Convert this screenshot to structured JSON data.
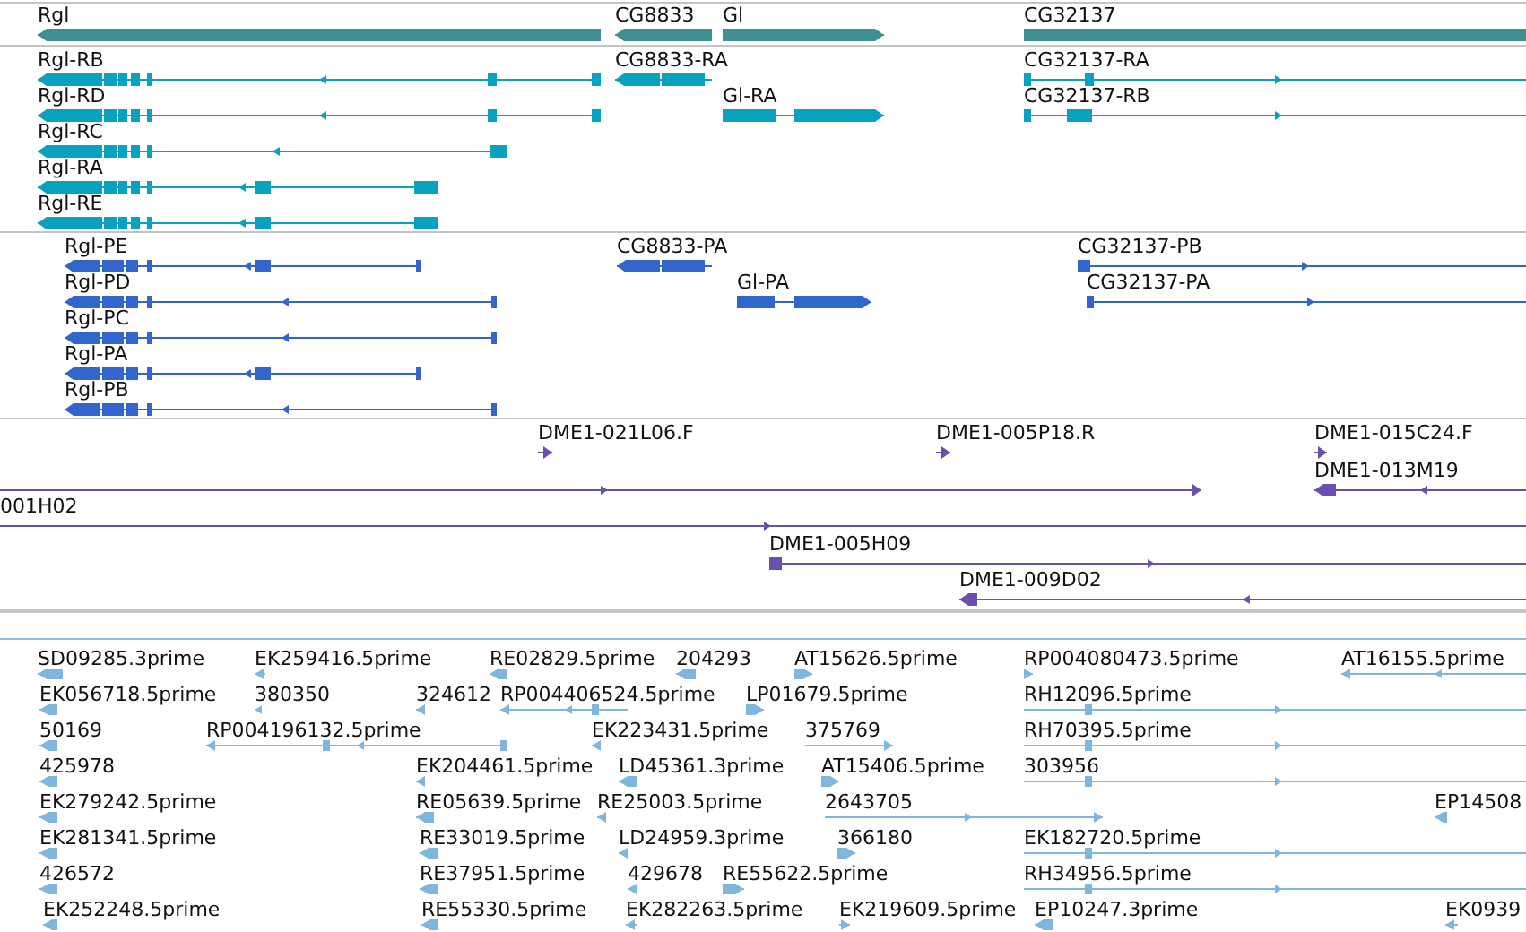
{
  "tracks": [
    {
      "kind": "genes",
      "color": "#3f8f94",
      "features": [
        {
          "label": "Rgl",
          "reverse": true
        },
        {
          "label": "CG8833",
          "reverse": true
        },
        {
          "label": "Gl",
          "reverse": false
        },
        {
          "label": "CG32137",
          "reverse": false
        }
      ]
    },
    {
      "kind": "transcripts",
      "color": "#0aa0c0",
      "features": [
        {
          "label": "Rgl-RB",
          "reverse": true
        },
        {
          "label": "CG8833-RA",
          "reverse": true
        },
        {
          "label": "CG32137-RA",
          "reverse": false
        },
        {
          "label": "Rgl-RD",
          "reverse": true
        },
        {
          "label": "Gl-RA",
          "reverse": false
        },
        {
          "label": "CG32137-RB",
          "reverse": false
        },
        {
          "label": "Rgl-RC",
          "reverse": true
        },
        {
          "label": "Rgl-RA",
          "reverse": true
        },
        {
          "label": "Rgl-RE",
          "reverse": true
        }
      ]
    },
    {
      "kind": "proteins",
      "color": "#3366cc",
      "features": [
        {
          "label": "Rgl-PE",
          "reverse": true
        },
        {
          "label": "CG8833-PA",
          "reverse": true
        },
        {
          "label": "CG32137-PB",
          "reverse": false
        },
        {
          "label": "Rgl-PD",
          "reverse": true
        },
        {
          "label": "Gl-PA",
          "reverse": false
        },
        {
          "label": "CG32137-PA",
          "reverse": false
        },
        {
          "label": "Rgl-PC",
          "reverse": true
        },
        {
          "label": "Rgl-PA",
          "reverse": true
        },
        {
          "label": "Rgl-PB",
          "reverse": true
        }
      ]
    },
    {
      "kind": "clones",
      "color": "#6a4fb0",
      "features": [
        {
          "label": "DME1-021L06.F",
          "reverse": false
        },
        {
          "label": "DME1-005P18.R",
          "reverse": false
        },
        {
          "label": "DME1-015C24.F",
          "reverse": false
        },
        {
          "reverse": false
        },
        {
          "label": "DME1-013M19",
          "reverse": true
        },
        {
          "label": "001H02",
          "reverse": false
        },
        {
          "label": "DME1-005H09",
          "reverse": false
        },
        {
          "label": "DME1-009D02",
          "reverse": true
        }
      ]
    },
    {
      "kind": "ests",
      "color": "#7fb6de",
      "features": [
        {
          "label": "SD09285.3prime",
          "reverse": true
        },
        {
          "label": "EK259416.5prime",
          "reverse": true
        },
        {
          "label": "RE02829.5prime",
          "reverse": true
        },
        {
          "label": "204293",
          "reverse": true
        },
        {
          "label": "AT15626.5prime",
          "reverse": false
        },
        {
          "label": "RP004080473.5prime",
          "reverse": false
        },
        {
          "label": "AT16155.5prime",
          "reverse": true
        },
        {
          "label": "EK056718.5prime",
          "reverse": true
        },
        {
          "label": "380350",
          "reverse": true
        },
        {
          "label": "324612",
          "reverse": true
        },
        {
          "label": "RP004406524.5prime",
          "reverse": true
        },
        {
          "label": "LP01679.5prime",
          "reverse": false
        },
        {
          "label": "RH12096.5prime",
          "reverse": false
        },
        {
          "label": "50169",
          "reverse": true
        },
        {
          "label": "RP004196132.5prime",
          "reverse": true
        },
        {
          "label": "EK223431.5prime",
          "reverse": true
        },
        {
          "label": "375769",
          "reverse": false
        },
        {
          "label": "RH70395.5prime",
          "reverse": false
        },
        {
          "label": "425978",
          "reverse": true
        },
        {
          "label": "EK204461.5prime",
          "reverse": true
        },
        {
          "label": "LD45361.3prime",
          "reverse": true
        },
        {
          "label": "AT15406.5prime",
          "reverse": false
        },
        {
          "label": "303956",
          "reverse": false
        },
        {
          "label": "EK279242.5prime",
          "reverse": true
        },
        {
          "label": "RE05639.5prime",
          "reverse": true
        },
        {
          "label": "RE25003.5prime",
          "reverse": true
        },
        {
          "label": "2643705",
          "reverse": false
        },
        {
          "label": "EP14508",
          "reverse": true
        },
        {
          "label": "EK281341.5prime",
          "reverse": true
        },
        {
          "label": "RE33019.5prime",
          "reverse": true
        },
        {
          "label": "LD24959.3prime",
          "reverse": true
        },
        {
          "label": "366180",
          "reverse": false
        },
        {
          "label": "EK182720.5prime",
          "reverse": false
        },
        {
          "label": "426572",
          "reverse": true
        },
        {
          "label": "RE37951.5prime",
          "reverse": true
        },
        {
          "label": "429678",
          "reverse": true
        },
        {
          "label": "RE55622.5prime",
          "reverse": false
        },
        {
          "label": "RH34956.5prime",
          "reverse": false
        },
        {
          "label": "EK252248.5prime",
          "reverse": true
        },
        {
          "label": "RE55330.5prime",
          "reverse": true
        },
        {
          "label": "EK282263.5prime",
          "reverse": true
        },
        {
          "label": "EK219609.5prime",
          "reverse": false
        },
        {
          "label": "EP10247.3prime",
          "reverse": true
        },
        {
          "label": "EK0939",
          "reverse": true
        }
      ]
    }
  ]
}
